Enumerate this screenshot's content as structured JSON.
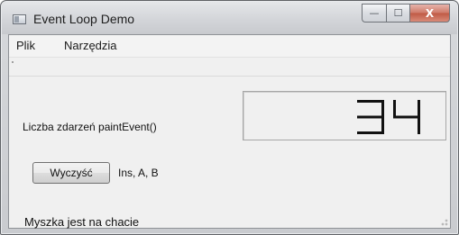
{
  "window": {
    "title": "Event Loop Demo",
    "minimize_label": "—",
    "maximize_label": "☐",
    "close_label": "X"
  },
  "menu": {
    "items": [
      {
        "label": "Plik"
      },
      {
        "label": "Narzędzia"
      }
    ]
  },
  "main": {
    "counter_label": "Liczba zdarzeń paintEvent()",
    "counter_value": "34",
    "clear_button_label": "Wyczyść",
    "keys_text": "Ins, A, B"
  },
  "statusbar": {
    "text": "Myszka jest na chacie"
  },
  "colors": {
    "lcd_segment": "#111111",
    "close_button": "#c05a45"
  }
}
